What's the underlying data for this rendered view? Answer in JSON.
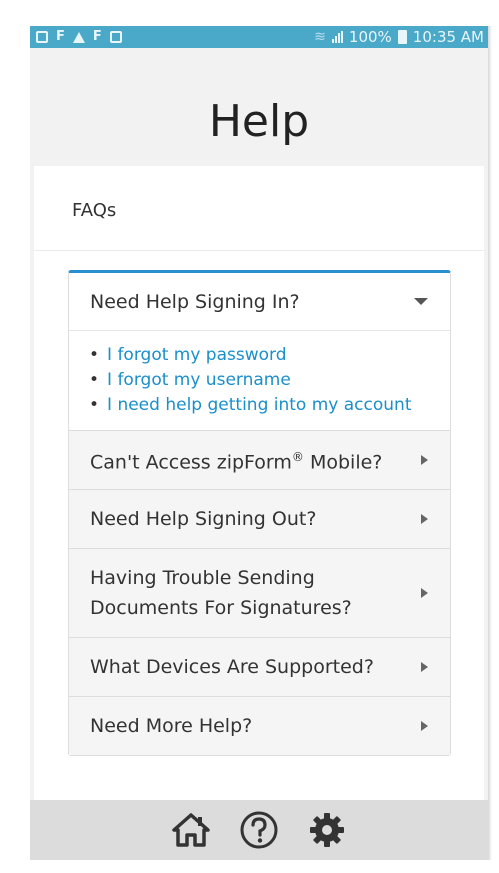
{
  "status_bar": {
    "battery": "100%",
    "time": "10:35 AM"
  },
  "header": {
    "title": "Help"
  },
  "faqs": {
    "title": "FAQs"
  },
  "accordion": {
    "items": [
      {
        "label": "Need Help Signing In?",
        "expanded": true,
        "links": [
          "I forgot my password",
          "I forgot my username",
          "I need help getting into my account"
        ]
      },
      {
        "label_prefix": "Can't Access zipForm",
        "label_sup": "®",
        "label_suffix": " Mobile?",
        "expanded": false
      },
      {
        "label": "Need Help Signing Out?",
        "expanded": false
      },
      {
        "label": "Having Trouble Sending Documents For Signatures?",
        "expanded": false
      },
      {
        "label": "What Devices Are Supported?",
        "expanded": false
      },
      {
        "label": "Need More Help?",
        "expanded": false
      }
    ]
  },
  "bottom_bar": {
    "icons": [
      "home-icon",
      "help-icon",
      "settings-gear-icon"
    ]
  },
  "colors": {
    "status_bar": "#4aa8c9",
    "accent": "#2a8fd0",
    "link": "#1a8fc9",
    "toolbar": "#dcdcdc"
  }
}
